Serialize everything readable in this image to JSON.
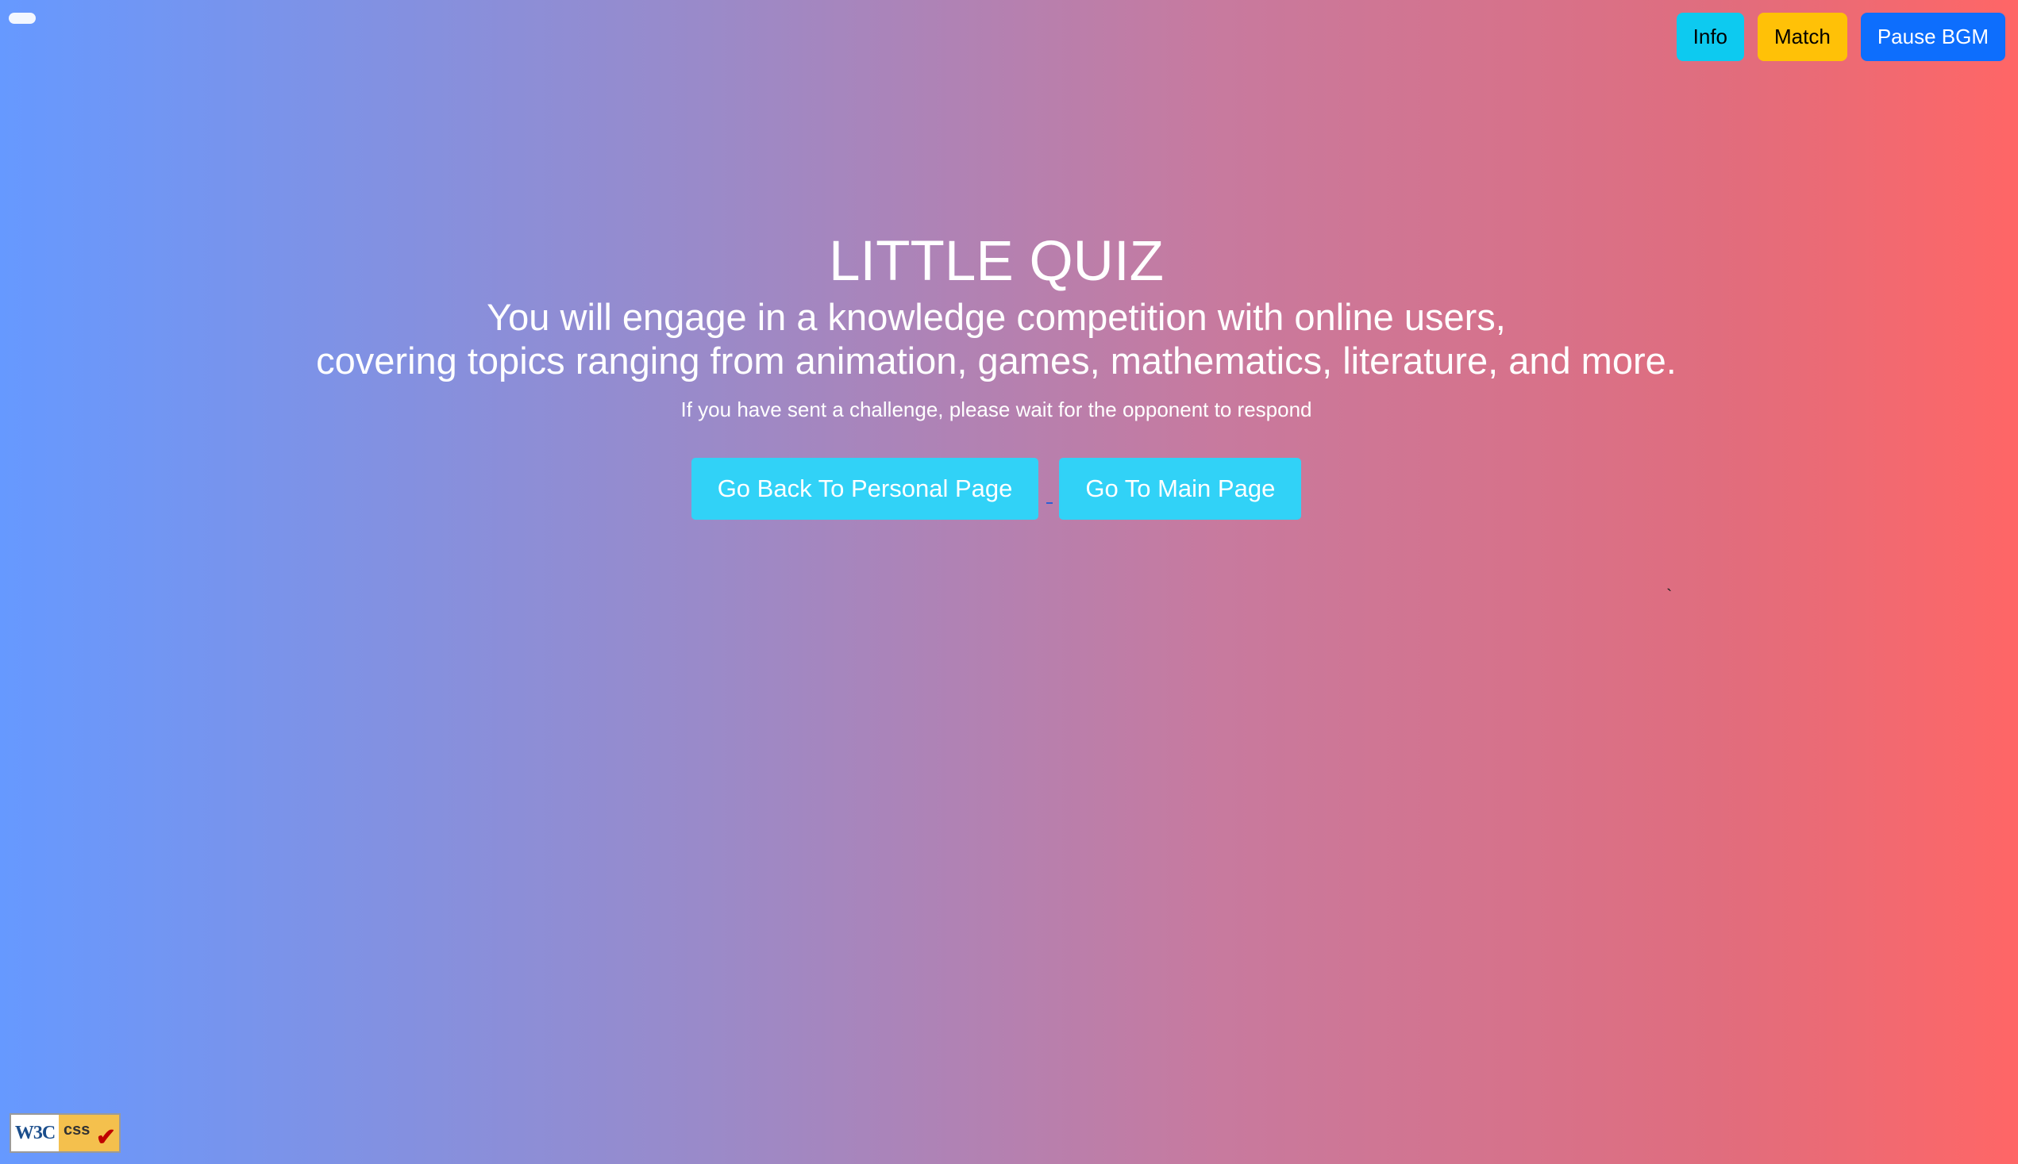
{
  "topbar": {
    "info_label": "Info",
    "match_label": "Match",
    "bgm_label": "Pause BGM"
  },
  "hero": {
    "title": "LITTLE QUIZ",
    "subtitle_line1": "You will engage in a knowledge competition with online users,",
    "subtitle_line2": "covering topics ranging from animation, games, mathematics, literature, and more.",
    "hint": "If you have sent a challenge, please wait for the opponent to respond"
  },
  "actions": {
    "personal_label": "Go Back To Personal Page",
    "main_label": "Go To Main Page"
  },
  "badge": {
    "w3c_text": "W3C",
    "css_text": "css",
    "check": "✔"
  },
  "colors": {
    "gradient_start": "#6699ff",
    "gradient_end": "#ff6666",
    "info": "#0dcaf0",
    "match": "#ffc107",
    "bgm": "#0d6efd",
    "action": "#31d2f7"
  },
  "icons": {
    "corner": "pill-toggle-icon",
    "badge": "w3c-css-validator-icon"
  }
}
